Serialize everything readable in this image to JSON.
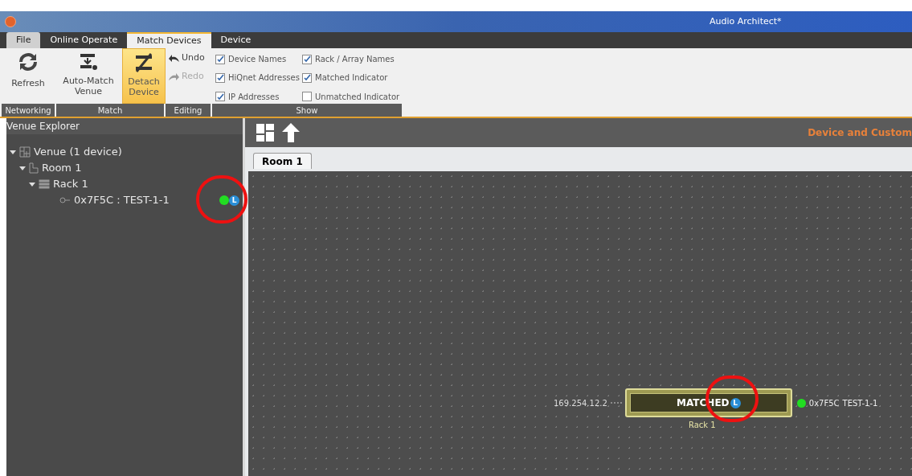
{
  "window": {
    "title": "Audio Architect*"
  },
  "menu_tabs": [
    {
      "label": "File",
      "selected": false,
      "kind": "file"
    },
    {
      "label": "Online Operate",
      "selected": false,
      "kind": "tab"
    },
    {
      "label": "Match Devices",
      "selected": true,
      "kind": "tab"
    },
    {
      "label": "Device",
      "selected": false,
      "kind": "tab"
    }
  ],
  "ribbon": {
    "refresh": {
      "label": "Refresh",
      "group": "Networking"
    },
    "match": {
      "group": "Match",
      "buttons": [
        {
          "label": "Auto-Match Venue",
          "selected": false,
          "kind": "auto-match"
        },
        {
          "label": "Detach Device",
          "selected": true,
          "kind": "detach"
        }
      ]
    },
    "editing": {
      "group": "Editing",
      "buttons": [
        {
          "label": "Undo",
          "disabled": false,
          "kind": "undo"
        },
        {
          "label": "Redo",
          "disabled": true,
          "kind": "redo"
        }
      ]
    },
    "show": {
      "group": "Show",
      "options": [
        {
          "label": "Device Names",
          "checked": true
        },
        {
          "label": "Rack / Array Names",
          "checked": true
        },
        {
          "label": "HiQnet Addresses",
          "checked": true
        },
        {
          "label": "Matched Indicator",
          "checked": true
        },
        {
          "label": "IP Addresses",
          "checked": true
        },
        {
          "label": "Unmatched Indicator",
          "checked": false
        }
      ]
    }
  },
  "sidebar": {
    "title": "Venue Explorer",
    "tree": [
      {
        "label": "Venue (1 device)",
        "kind": "venue",
        "expanded": true,
        "children": [
          {
            "label": "Room 1",
            "kind": "room",
            "expanded": true,
            "children": [
              {
                "label": "Rack 1",
                "kind": "rack",
                "expanded": true,
                "children": [
                  {
                    "label": "0x7F5C : TEST-1-1",
                    "kind": "device",
                    "color": "#22dd22",
                    "badge": "L"
                  }
                ]
              }
            ]
          }
        ]
      }
    ]
  },
  "canvas": {
    "header_title": "Device and Custom",
    "tabs": [
      {
        "label": "Room 1",
        "selected": true
      }
    ],
    "device": {
      "ip": "169.254.12.2",
      "status": "MATCHED",
      "badge": "L",
      "rack": "Rack 1",
      "color": "#22dd22",
      "address": "0x7F5C",
      "name": "TEST-1-1"
    }
  }
}
